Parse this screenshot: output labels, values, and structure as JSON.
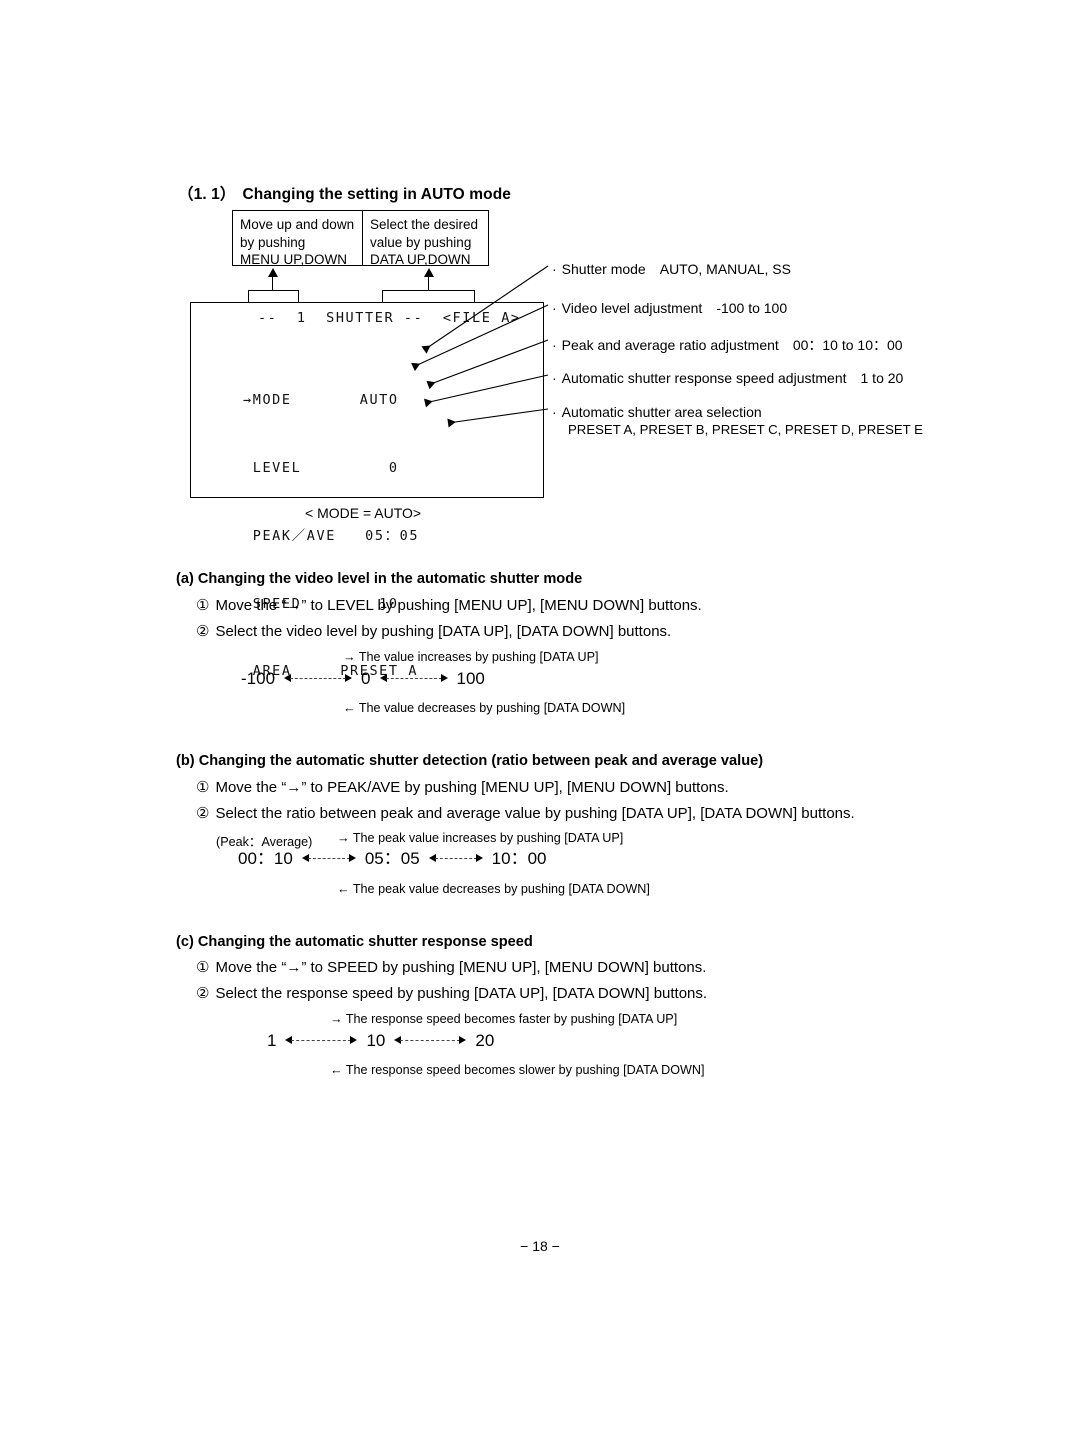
{
  "section": {
    "number": "（1. 1）",
    "title": "Changing the setting in AUTO mode"
  },
  "callouts": [
    {
      "id": "menu",
      "text": "Move up and down\nby pushing\nMENU UP,DOWN"
    },
    {
      "id": "data",
      "text": "Select the desired\nvalue by pushing\nDATA UP,DOWN"
    }
  ],
  "osd": {
    "title": "--  1  SHUTTER --  <FILE A>",
    "rows": [
      "→MODE       AUTO",
      " LEVEL         0",
      " PEAK／AVE   05：05",
      " SPEED        10",
      " AREA     PRESET A"
    ],
    "caption": "< MODE = AUTO>"
  },
  "annotations": [
    {
      "bullet": "·",
      "label": "Shutter mode",
      "value": "AUTO, MANUAL, SS"
    },
    {
      "bullet": "·",
      "label": "Video level adjustment",
      "value": "-100 to 100"
    },
    {
      "bullet": "·",
      "label": "Peak and average ratio adjustment",
      "value": "00：10 to 10：00"
    },
    {
      "bullet": "·",
      "label": "Automatic shutter response speed adjustment",
      "value": "1 to 20"
    },
    {
      "bullet": "·",
      "label": "Automatic shutter area selection",
      "value": ""
    }
  ],
  "annotation_sub": "PRESET A, PRESET B, PRESET C, PRESET D, PRESET E",
  "sections": [
    {
      "heading": "(a) Changing the video level in the automatic shutter mode",
      "steps": [
        {
          "num": "①",
          "text": "Move the “→” to LEVEL by pushing [MENU UP], [MENU DOWN] buttons."
        },
        {
          "num": "②",
          "text": "Select the video level by pushing [DATA UP], [DATA DOWN] buttons."
        }
      ],
      "note_up": "→  The value increases by pushing [DATA UP]",
      "note_down": "←  The value decreases by pushing [DATA DOWN]",
      "range": {
        "prefix": "",
        "min": "-100",
        "mid": "0",
        "max": "100"
      }
    },
    {
      "heading": "(b) Changing the automatic shutter detection (ratio between peak and average value)",
      "steps": [
        {
          "num": "①",
          "text": "Move the “→” to PEAK/AVE by pushing [MENU UP], [MENU DOWN] buttons."
        },
        {
          "num": "②",
          "text": "Select the ratio between peak and average value by pushing [DATA UP], [DATA DOWN] buttons."
        }
      ],
      "note_up": "→  The peak value increases by pushing [DATA UP]",
      "note_down": "←  The peak value decreases by pushing [DATA DOWN]",
      "range": {
        "prefix": "(Peak：Average)",
        "min": "00：10",
        "mid": "05：05",
        "max": "10：00"
      }
    },
    {
      "heading": "(c) Changing the automatic shutter response speed",
      "steps": [
        {
          "num": "①",
          "text": "Move the “→” to SPEED by pushing [MENU UP], [MENU DOWN] buttons."
        },
        {
          "num": "②",
          "text": "Select the response speed by pushing [DATA UP], [DATA DOWN] buttons."
        }
      ],
      "note_up": "→  The response speed becomes faster by pushing [DATA UP]",
      "note_down": "←  The response speed becomes slower by pushing [DATA DOWN]",
      "range": {
        "prefix": "",
        "min": "1",
        "mid": "10",
        "max": "20"
      }
    }
  ],
  "footer": {
    "page": "− 18 −"
  }
}
